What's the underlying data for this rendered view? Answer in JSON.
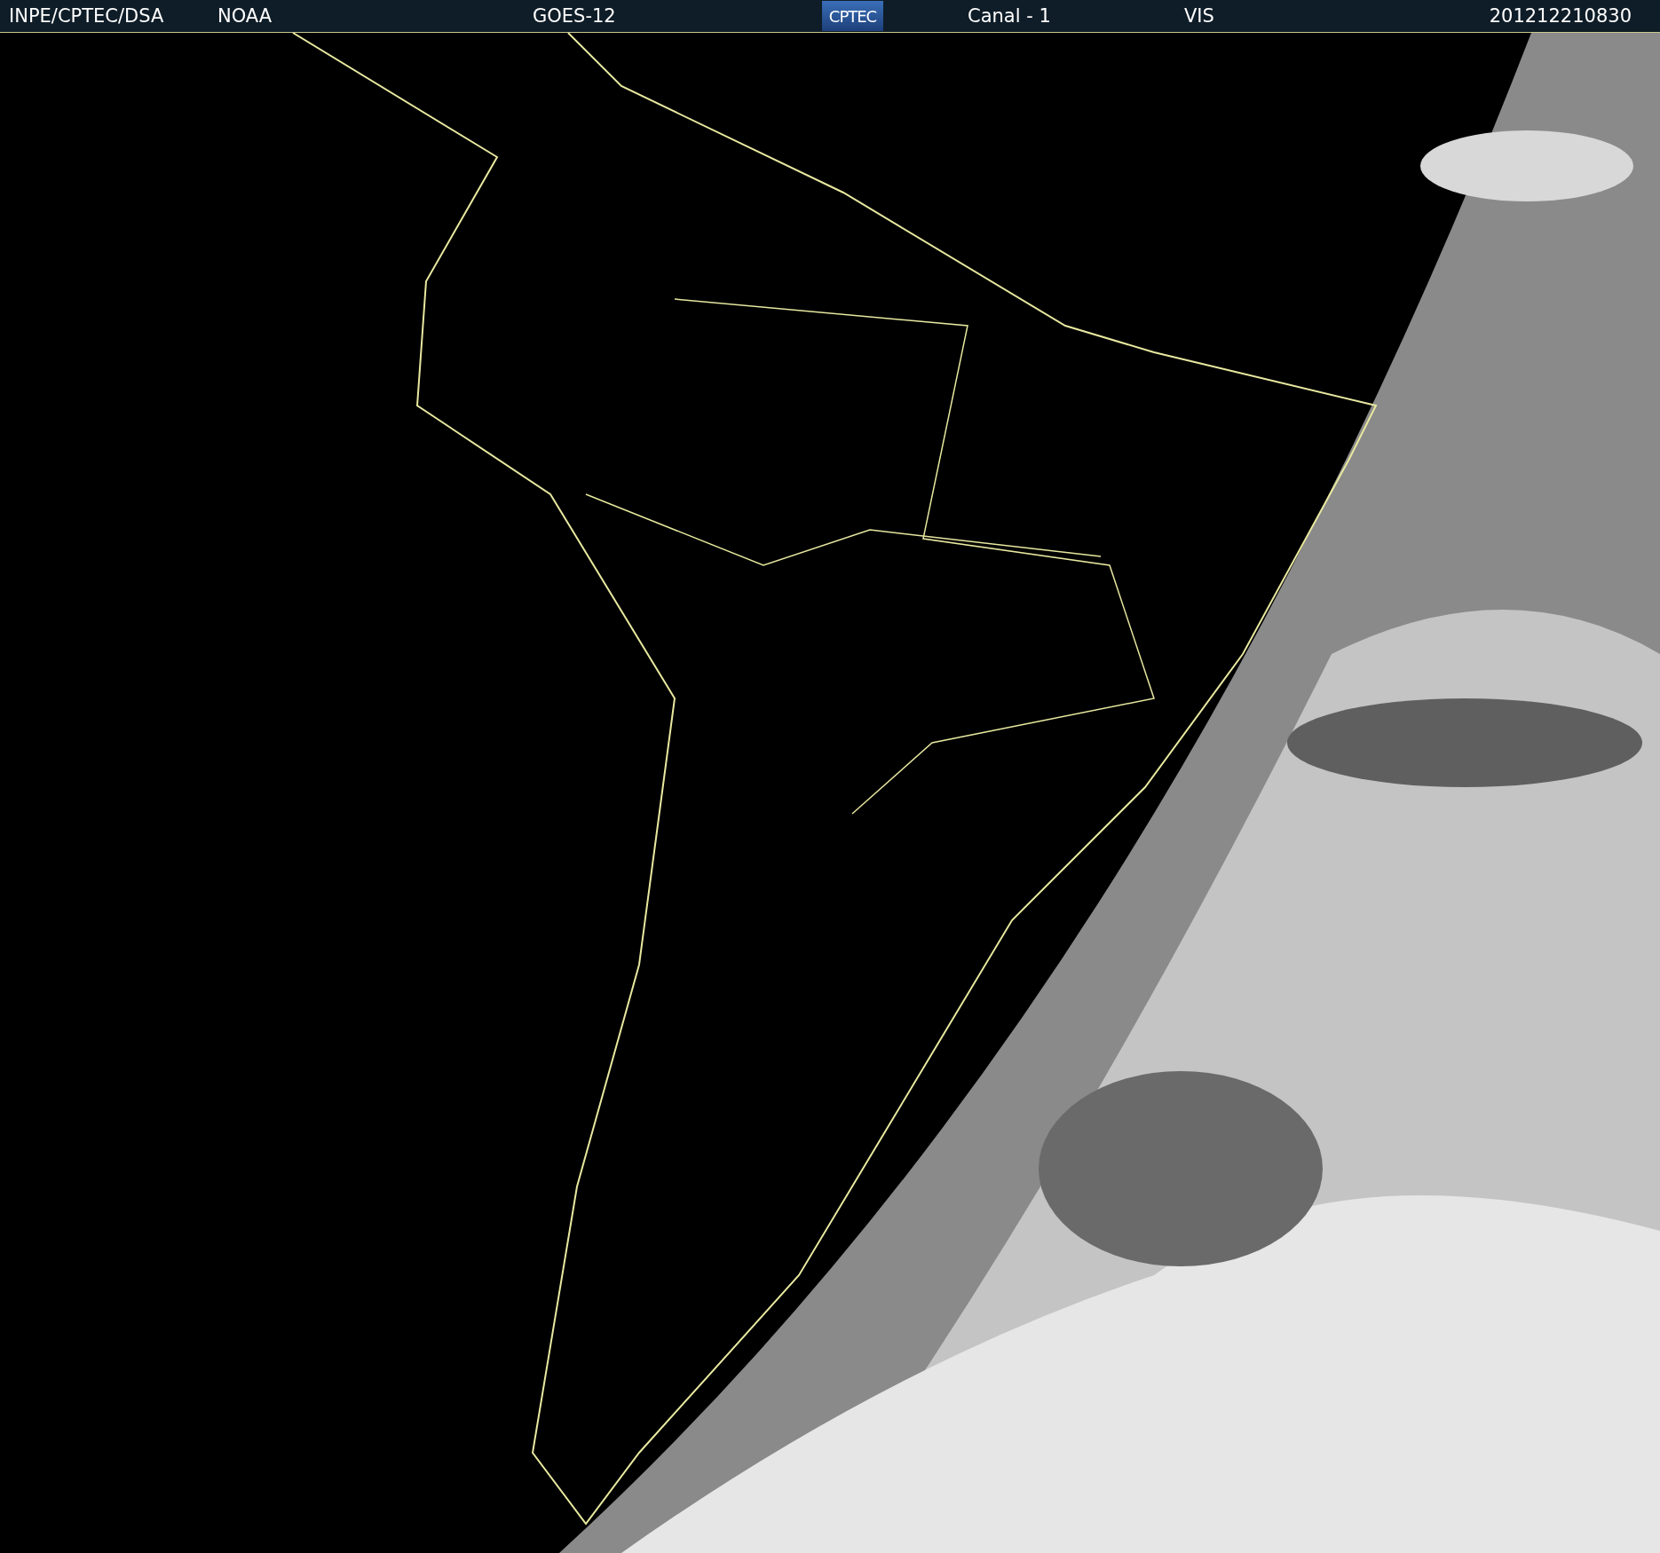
{
  "header": {
    "source": "INPE/CPTEC/DSA",
    "agency": "NOAA",
    "satellite": "GOES-12",
    "logo": "CPTEC",
    "channel": "Canal - 1",
    "band": "VIS",
    "timestamp": "201212210830"
  }
}
